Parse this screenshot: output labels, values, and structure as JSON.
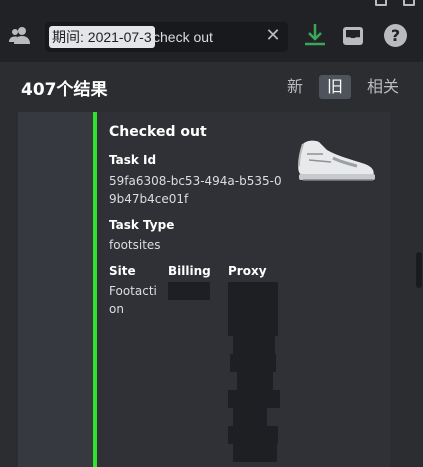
{
  "header": {
    "search_filter": "期间: 2021-07-3",
    "search_query": "check out",
    "clear_symbol": "✕",
    "help_symbol": "?"
  },
  "results": {
    "count_label": "407个结果",
    "sort_tabs": [
      "新",
      "旧",
      "相关"
    ],
    "active_sort": "旧"
  },
  "embed": {
    "accent_color": "#2fe32b",
    "title": "Checked out",
    "task_id_label": "Task Id",
    "task_id_value": "59fa6308-bc53-494a-b535-09b47b4ce01f",
    "task_type_label": "Task Type",
    "task_type_value": "footsites",
    "site_label": "Site",
    "site_value": "Footaction",
    "billing_label": "Billing",
    "proxy_label": "Proxy"
  }
}
